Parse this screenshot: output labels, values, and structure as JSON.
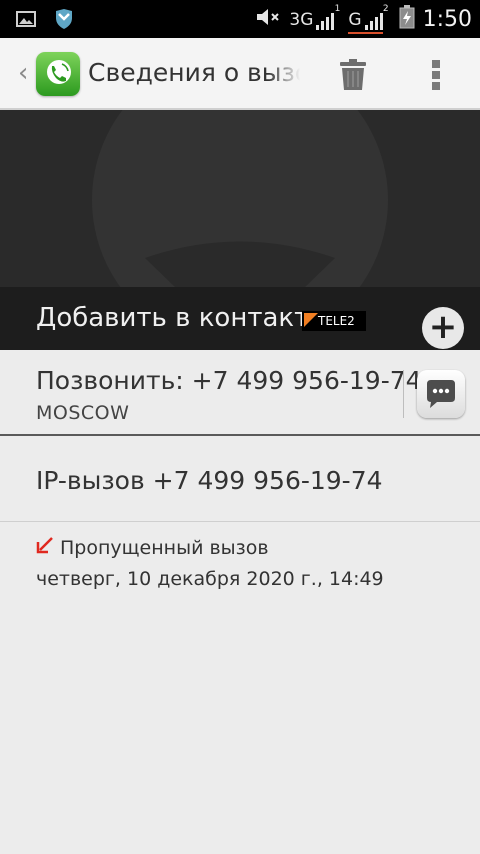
{
  "status_bar": {
    "network_3g": "3G",
    "sim1_index": "1",
    "network_g": "G",
    "sim2_index": "2",
    "time": "1:50",
    "icons": [
      "image-icon",
      "shield-icon",
      "mute-icon",
      "signal-icon",
      "battery-charging-icon"
    ]
  },
  "action_bar": {
    "back_glyph": "‹",
    "title": "Сведения о вызове",
    "icons": [
      "phone-app-icon",
      "trash-icon",
      "overflow-menu-icon"
    ]
  },
  "contact_header": {
    "add_to_contacts": "Добавить в контакт",
    "operator": "TELE2",
    "add_button_glyph": "+"
  },
  "call_row": {
    "call_label": "Позвонить: +7 499 956-19-74",
    "location": "MOSCOW"
  },
  "ip_call": {
    "label": "IP-вызов +7 499 956-19-74"
  },
  "history": {
    "missed_label": "Пропущенный вызов",
    "date": "четверг, 10 декабря 2020 г., 14:49"
  },
  "colors": {
    "missed_arrow": "#e0281f",
    "operator_flag": "#f07e22"
  }
}
